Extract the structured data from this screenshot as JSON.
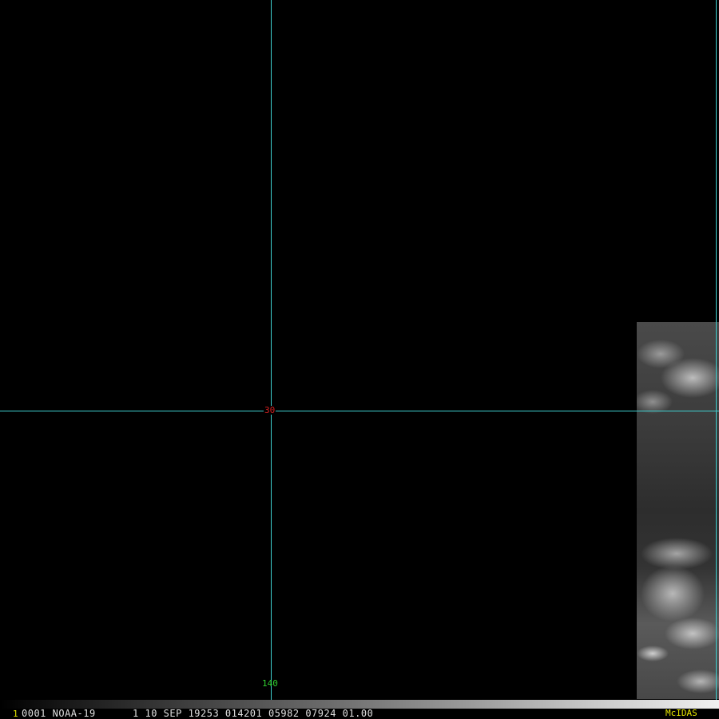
{
  "grid": {
    "latitude_label": "30",
    "longitude_label": "140"
  },
  "status_bar": {
    "frame_number": "1",
    "info_text": "0001 NOAA-19      1 10 SEP 19253 014201 05982 07924 01.00",
    "brand": "McIDAS"
  },
  "colors": {
    "grid_line": "#3fd0d0",
    "latitude_label": "#d02020",
    "longitude_label": "#30d030",
    "brand": "#e8e800",
    "background": "#000000"
  }
}
